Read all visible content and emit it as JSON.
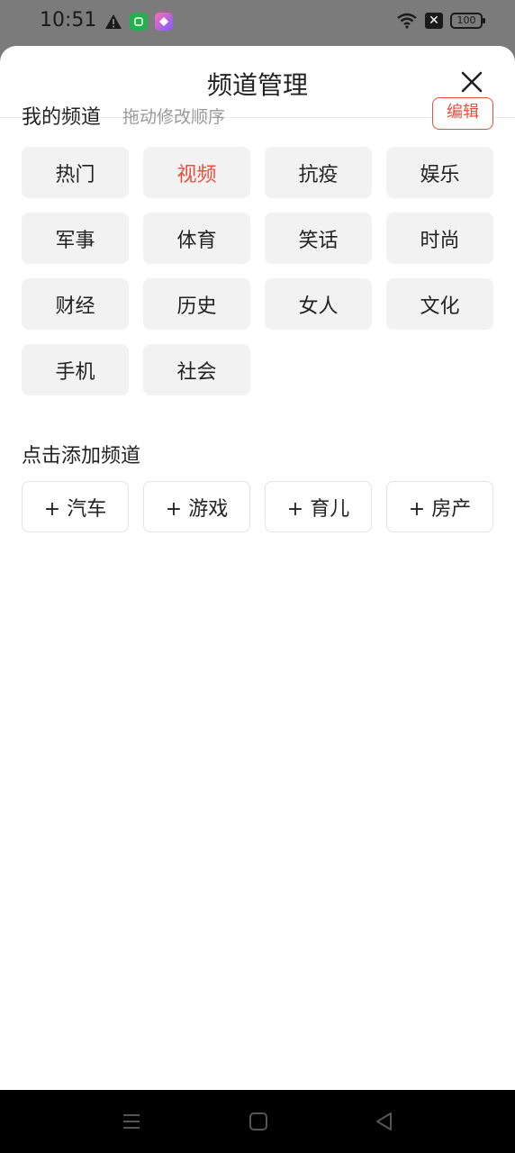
{
  "status": {
    "time": "10:51",
    "battery": "100"
  },
  "sheet": {
    "title": "频道管理"
  },
  "my_channels": {
    "label": "我的频道",
    "hint": "拖动修改顺序",
    "edit_label": "编辑",
    "items": [
      {
        "label": "热门",
        "active": false
      },
      {
        "label": "视频",
        "active": true
      },
      {
        "label": "抗疫",
        "active": false
      },
      {
        "label": "娱乐",
        "active": false
      },
      {
        "label": "军事",
        "active": false
      },
      {
        "label": "体育",
        "active": false
      },
      {
        "label": "笑话",
        "active": false
      },
      {
        "label": "时尚",
        "active": false
      },
      {
        "label": "财经",
        "active": false
      },
      {
        "label": "历史",
        "active": false
      },
      {
        "label": "女人",
        "active": false
      },
      {
        "label": "文化",
        "active": false
      },
      {
        "label": "手机",
        "active": false
      },
      {
        "label": "社会",
        "active": false
      }
    ]
  },
  "add_channels": {
    "label": "点击添加频道",
    "items": [
      {
        "label": "+ 汽车"
      },
      {
        "label": "+ 游戏"
      },
      {
        "label": "+ 育儿"
      },
      {
        "label": "+ 房产"
      }
    ]
  },
  "colors": {
    "accent": "#e5503f"
  },
  "icons": {
    "close": "close-icon",
    "nav_menu": "menu-icon",
    "nav_home": "home-square-icon",
    "nav_back": "back-triangle-icon"
  }
}
